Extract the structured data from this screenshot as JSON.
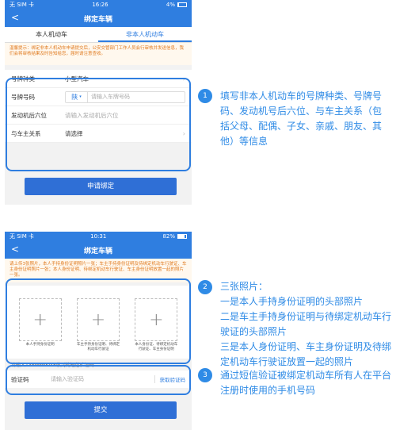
{
  "screens": [
    {
      "status": {
        "carrier": "无 SIM 卡",
        "time": "16:26",
        "battery": "4%",
        "battery_level": 0.04
      },
      "title": "绑定车辆",
      "tabs": [
        {
          "label": "本人机动车"
        },
        {
          "label": "非本人机动车"
        }
      ],
      "notice": "温馨提示：绑定非本人机动车申请提交后，公安交管部门工作人员会行审核并发送信息，我们会将审核结果及时告知给您，届时请注意查收。",
      "fields": {
        "plate_type": {
          "label": "号牌种类",
          "value": "小型汽车"
        },
        "plate_no": {
          "label": "号牌号码",
          "prefix": "陕",
          "placeholder": "请输入车牌号码"
        },
        "engine": {
          "label": "发动机后六位",
          "placeholder": "请输入发动机后六位"
        },
        "relation": {
          "label": "与车主关系",
          "placeholder": "请选择"
        }
      },
      "submit_label": "申请绑定"
    },
    {
      "status": {
        "carrier": "无 SIM 卡",
        "time": "10:31",
        "battery": "82%",
        "battery_level": 0.82
      },
      "title": "绑定车辆",
      "notice": "请上传3张照片，本人手持身份证明照片一张；车主手持身份证明及待绑定机动车行驶证、车主身份证明照片一张；本人身份证明、待绑定机动车行驶证、车主身份证明放置一起的照片一张。",
      "photos": [
        {
          "caption": "本人手持身份证明"
        },
        {
          "caption": "车主手持身份证明、待绑定机动车行驶证"
        },
        {
          "caption": "本人身份证、待绑定机动车行驶证、车主身份证明"
        }
      ],
      "sms_tip": "请输入138****9048收到的短信验证码",
      "code_label": "验证码",
      "code_placeholder": "请输入验证码",
      "get_code": "获取验证码",
      "submit_label": "提交"
    }
  ],
  "annotations": [
    {
      "num": "1",
      "text": "填写非本人机动车的号牌种类、号牌号码、发动机号后六位、与车主关系（包括父母、配偶、子女、亲戚、朋友、其他）等信息"
    },
    {
      "num": "2",
      "lines": [
        "三张照片：",
        "一是本人手持身份证明的头部照片",
        "二是车主手持身份证明与待绑定机动车行驶证的头部照片",
        "三是本人身份证明、车主身份证明及待绑定机动车行驶证放置一起的照片"
      ]
    },
    {
      "num": "3",
      "text": "通过短信验证被绑定机动车所有人在平台注册时使用的手机号码"
    }
  ],
  "colors": {
    "accent": "#2f7ee0",
    "annotation": "#2f8be6",
    "notice": "#e07a1f"
  }
}
